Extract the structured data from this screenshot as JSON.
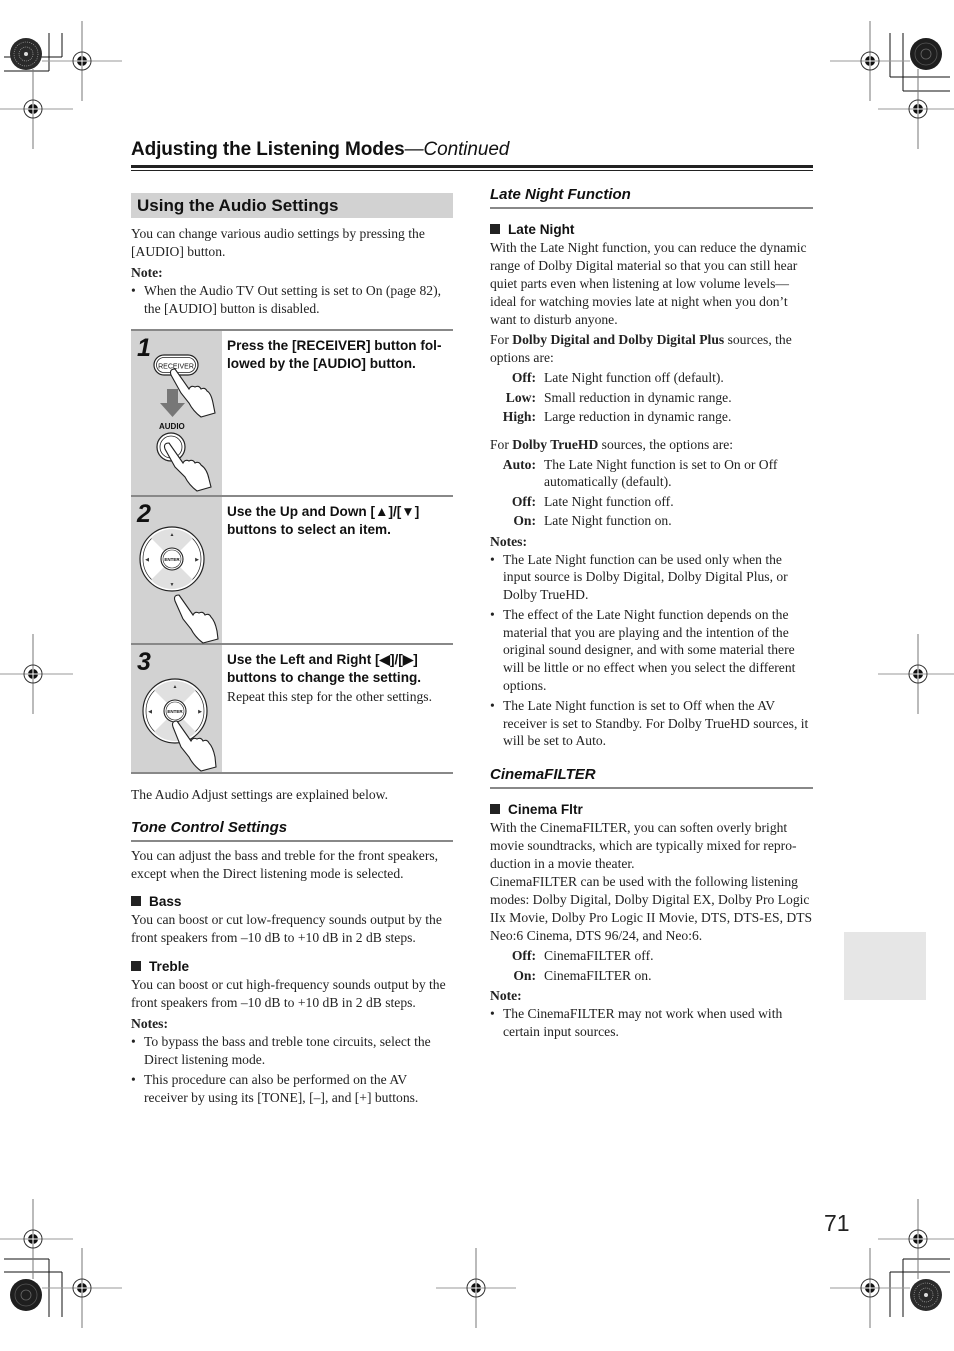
{
  "header": {
    "title": "Adjusting the Listening Modes",
    "continued": "—Continued"
  },
  "audio_settings": {
    "banner": "Using the Audio Settings",
    "intro": "You can change various audio settings by pressing the [AUDIO] button.",
    "note_label": "Note:",
    "notes": [
      "When the Audio TV Out setting is set to On (page 82), the [AUDIO] button is disabled."
    ],
    "steps": [
      {
        "number": "1",
        "heading": "Press the [RECEIVER] button fol-lowed by the [AUDIO] button.",
        "sub": "",
        "illus_labels": {
          "receiver": "RECEIVER",
          "audio": "AUDIO"
        }
      },
      {
        "number": "2",
        "heading": "Use the Up and Down [▲]/[▼] buttons to select an item.",
        "sub": "",
        "illus_labels": {
          "enter": "ENTER"
        }
      },
      {
        "number": "3",
        "heading": "Use the Left and Right [◀]/[▶] buttons to change the setting.",
        "sub": "Repeat this step for the other settings.",
        "illus_labels": {
          "enter": "ENTER"
        }
      }
    ],
    "after_steps": "The Audio Adjust settings are explained below."
  },
  "tone_control": {
    "heading": "Tone Control Settings",
    "intro": "You can adjust the bass and treble for the front speakers, except when the Direct listening mode is selected.",
    "bass": {
      "label": "Bass",
      "text": "You can boost or cut low-frequency sounds output by the front speakers from –10 dB to +10 dB in 2 dB steps."
    },
    "treble": {
      "label": "Treble",
      "text": "You can boost or cut high-frequency sounds output by the front speakers from –10 dB to +10 dB in 2 dB steps."
    },
    "notes_label": "Notes:",
    "notes": [
      "To bypass the bass and treble tone circuits, select the Direct listening mode.",
      "This procedure can also be performed on the AV receiver by using its [TONE], [–], and [+] buttons."
    ]
  },
  "late_night": {
    "heading": "Late Night Function",
    "item_label": "Late Night",
    "intro": "With the Late Night function, you can reduce the dynamic range of Dolby Digital material so that you can still hear quiet parts even when listening at low volume levels—ideal for watching movies late at night when you don’t want to disturb anyone.",
    "dd_prefix": "For ",
    "dd_bold": "Dolby Digital and Dolby Digital Plus",
    "dd_suffix": " sources, the options are:",
    "dd_options": [
      {
        "key": "Off:",
        "desc": "Late Night function off (default)."
      },
      {
        "key": "Low:",
        "desc": "Small reduction in dynamic range."
      },
      {
        "key": "High:",
        "desc": "Large reduction in dynamic range."
      }
    ],
    "thd_prefix": "For ",
    "thd_bold": "Dolby TrueHD",
    "thd_suffix": " sources, the options are:",
    "thd_options": [
      {
        "key": "Auto:",
        "desc": "The Late Night function is set to On or Off automatically (default)."
      },
      {
        "key": "Off:",
        "desc": "Late Night function off."
      },
      {
        "key": "On:",
        "desc": "Late Night function on."
      }
    ],
    "notes_label": "Notes:",
    "notes": [
      "The Late Night function can be used only when the input source is Dolby Digital, Dolby Digital Plus, or Dolby TrueHD.",
      "The effect of the Late Night function depends on the material that you are playing and the intention of the original sound designer, and with some material there will be little or no effect when you select the different options.",
      "The Late Night function is set to Off when the AV receiver is set to Standby. For Dolby TrueHD sources, it will be set to Auto."
    ]
  },
  "cinema_filter": {
    "heading": "CinemaFILTER",
    "item_label": "Cinema Fltr",
    "intro": "With the CinemaFILTER, you can soften overly bright movie soundtracks, which are typically mixed for repro-duction in a movie theater.",
    "modes_text": "CinemaFILTER can be used with the following listening modes: Dolby Digital, Dolby Digital EX, Dolby Pro Logic IIx Movie, Dolby Pro Logic II Movie, DTS, DTS-ES, DTS Neo:6 Cinema, DTS 96/24, and Neo:6.",
    "options": [
      {
        "key": "Off:",
        "desc": "CinemaFILTER off."
      },
      {
        "key": "On:",
        "desc": "CinemaFILTER on."
      }
    ],
    "note_label": "Note:",
    "notes": [
      "The CinemaFILTER may not work when used with certain input sources."
    ]
  },
  "page_number": "71"
}
